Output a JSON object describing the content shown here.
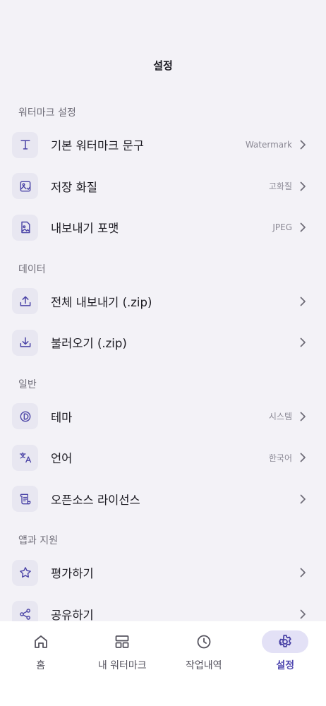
{
  "header": {
    "title": "설정"
  },
  "sections": {
    "watermark": {
      "title": "워터마크 설정",
      "items": [
        {
          "label": "기본 워터마크 문구",
          "value": "Watermark",
          "icon": "text-icon"
        },
        {
          "label": "저장 화질",
          "value": "고화질",
          "icon": "image-quality-icon"
        },
        {
          "label": "내보내기 포맷",
          "value": "JPEG",
          "icon": "image-file-icon"
        }
      ]
    },
    "data": {
      "title": "데이터",
      "items": [
        {
          "label": "전체 내보내기 (.zip)",
          "value": "",
          "icon": "upload-icon"
        },
        {
          "label": "불러오기 (.zip)",
          "value": "",
          "icon": "download-icon"
        }
      ]
    },
    "general": {
      "title": "일반",
      "items": [
        {
          "label": "테마",
          "value": "시스템",
          "icon": "theme-icon"
        },
        {
          "label": "언어",
          "value": "한국어",
          "icon": "translate-icon"
        },
        {
          "label": "오픈소스 라이선스",
          "value": "",
          "icon": "license-scroll-icon"
        }
      ]
    },
    "support": {
      "title": "앱과 지원",
      "items": [
        {
          "label": "평가하기",
          "value": "",
          "icon": "star-icon"
        },
        {
          "label": "공유하기",
          "value": "",
          "icon": "share-icon"
        }
      ]
    }
  },
  "bottom_nav": {
    "items": [
      {
        "label": "홈",
        "icon": "home-icon",
        "active": false
      },
      {
        "label": "내 워터마크",
        "icon": "layout-icon",
        "active": false
      },
      {
        "label": "작업내역",
        "icon": "history-clock-icon",
        "active": false
      },
      {
        "label": "설정",
        "icon": "gear-icon",
        "active": true
      }
    ]
  },
  "colors": {
    "background": "#f3f2f7",
    "icon_tile": "#e8e7f1",
    "accent": "#5048b0",
    "active_pill": "#e3e1f6"
  }
}
